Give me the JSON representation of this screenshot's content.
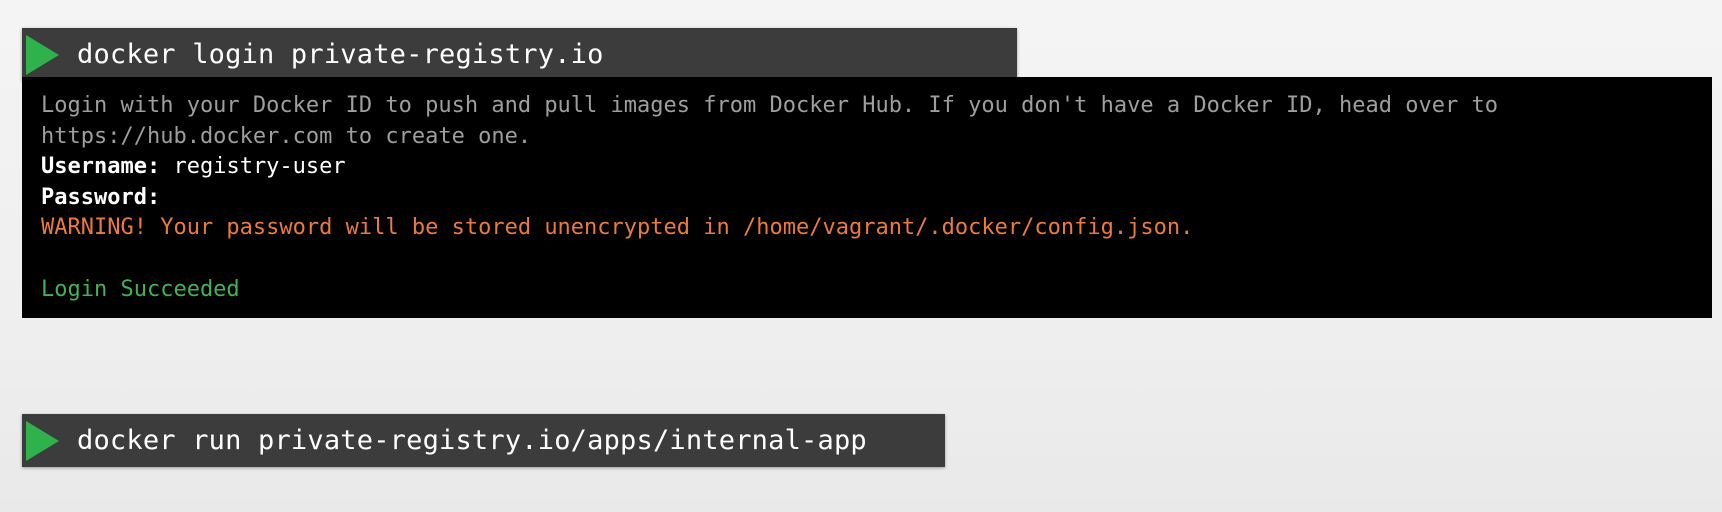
{
  "commands": [
    {
      "prompt_icon": "play-icon",
      "text": "docker login private-registry.io"
    },
    {
      "prompt_icon": "play-icon",
      "text": "docker run private-registry.io/apps/internal-app"
    }
  ],
  "terminal": {
    "info_line_1": "Login with your Docker ID to push and pull images from Docker Hub. If you don't have a Docker ID, head over to",
    "info_line_2": "https://hub.docker.com to create one.",
    "username_label": "Username:",
    "username_value": "registry-user",
    "password_label": "Password:",
    "warning": "WARNING! Your password will be stored unencrypted in /home/vagrant/.docker/config.json.",
    "result": "Login Succeeded"
  },
  "colors": {
    "command_bar": "#3c3c3c",
    "play_icon": "#2fb24c",
    "warning": "#ec7a3a",
    "success": "#3fb356",
    "muted_text": "#9e9e9e"
  }
}
